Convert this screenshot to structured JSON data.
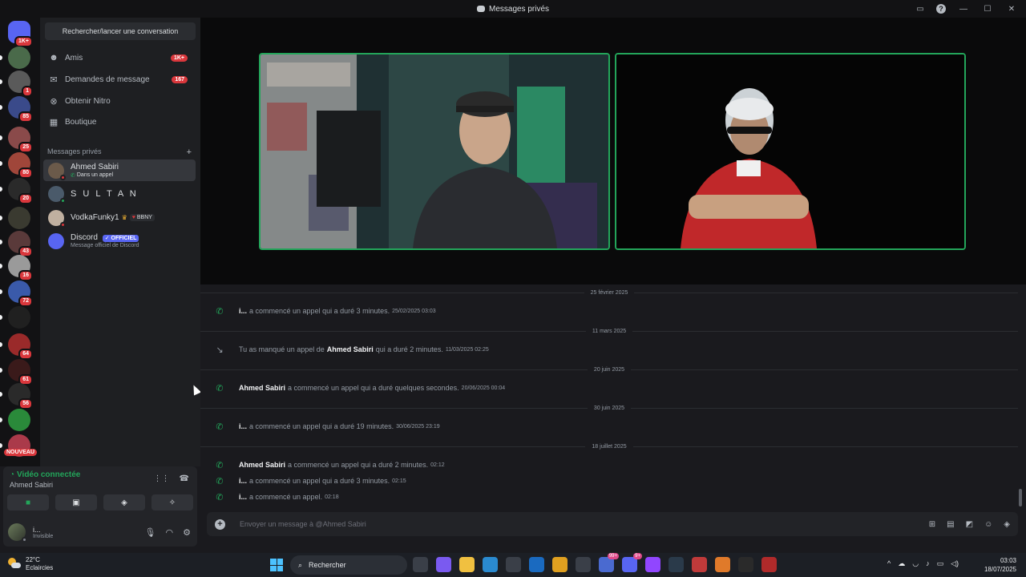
{
  "window": {
    "title": "Messages privés"
  },
  "colors": {
    "accent_green": "#23a55a",
    "badge_red": "#da373c",
    "blurple": "#5865f2"
  },
  "servers": [
    {
      "name": "discord-home",
      "color": "#5865f2",
      "badge": "1K+"
    },
    {
      "name": "server-1",
      "color": "#4a6a4a",
      "badge": ""
    },
    {
      "name": "server-2",
      "color": "#5a5a5a",
      "badge": "1"
    },
    {
      "name": "server-3",
      "color": "#3a4a8a",
      "badge": "85"
    },
    {
      "name": "server-4",
      "color": "#8a4a4a",
      "badge": "25"
    },
    {
      "name": "server-5",
      "color": "#a0463a",
      "badge": "80"
    },
    {
      "name": "server-6",
      "color": "#2a2a2a",
      "badge": "20"
    },
    {
      "name": "server-7",
      "color": "#3a3a30",
      "badge": ""
    },
    {
      "name": "server-8",
      "color": "#5a3a3a",
      "badge": "43"
    },
    {
      "name": "server-9",
      "color": "#9a9a9a",
      "badge": "16"
    },
    {
      "name": "server-10",
      "color": "#3a5aaa",
      "badge": "72"
    },
    {
      "name": "server-11",
      "color": "#202020",
      "badge": ""
    },
    {
      "name": "server-12",
      "color": "#9a2a2a",
      "badge": "64"
    },
    {
      "name": "server-13",
      "color": "#3a1a1a",
      "badge": "61"
    },
    {
      "name": "server-14",
      "color": "#2a2a2a",
      "badge": "56"
    },
    {
      "name": "server-15",
      "color": "#2a8a3a",
      "badge": ""
    },
    {
      "name": "server-16",
      "color": "#aa3a4a",
      "badge": ""
    }
  ],
  "server_new_label": "NOUVEAU",
  "sidebar": {
    "search_label": "Rechercher/lancer une conversation",
    "nav": [
      {
        "label": "Amis",
        "badge": "1K+",
        "icon": "friends-icon"
      },
      {
        "label": "Demandes de message",
        "badge": "167",
        "icon": "inbox-icon"
      },
      {
        "label": "Obtenir Nitro",
        "badge": "",
        "icon": "nitro-icon"
      },
      {
        "label": "Boutique",
        "badge": "",
        "icon": "shop-icon"
      }
    ],
    "section_title": "Messages privés",
    "dms": [
      {
        "name": "Ahmed Sabiri",
        "sub": "Dans un appel",
        "status_color": "#da373c",
        "avatar": "#6b5a4a"
      },
      {
        "name": "S U L T A N",
        "sub": "",
        "status_color": "#23a55a",
        "avatar": "#4a5a6a"
      },
      {
        "name": "VodkaFunky1",
        "tag": "BBNY",
        "status_color": "#da373c",
        "avatar": "#c0b0a0"
      },
      {
        "name": "Discord",
        "badge": "OFFICIEL",
        "sub": "Message officiel de Discord",
        "status_color": "",
        "avatar": "#5865f2"
      }
    ]
  },
  "voice": {
    "status": "Vidéo connectée",
    "channel": "Ahmed Sabiri"
  },
  "user": {
    "name": "i...",
    "status": "Invisible"
  },
  "chat": {
    "entries": [
      {
        "type": "date",
        "label": "25 février 2025"
      },
      {
        "type": "call",
        "missed": false,
        "author": "i...",
        "text": "a commencé un appel qui a duré 3 minutes.",
        "ts": "25/02/2025 03:03"
      },
      {
        "type": "date",
        "label": "11 mars 2025"
      },
      {
        "type": "call",
        "missed": true,
        "prefix": "Tu as manqué un appel de",
        "author": "Ahmed Sabiri",
        "text": "qui a duré 2 minutes.",
        "ts": "11/03/2025 02:25"
      },
      {
        "type": "date",
        "label": "20 juin 2025"
      },
      {
        "type": "call",
        "missed": false,
        "author": "Ahmed Sabiri",
        "text": "a commencé un appel qui a duré quelques secondes.",
        "ts": "20/06/2025 00:04"
      },
      {
        "type": "date",
        "label": "30 juin 2025"
      },
      {
        "type": "call",
        "missed": false,
        "author": "i...",
        "text": "a commencé un appel qui a duré 19 minutes.",
        "ts": "30/06/2025 23:19"
      },
      {
        "type": "date",
        "label": "18 juillet 2025"
      },
      {
        "type": "call",
        "missed": false,
        "author": "Ahmed Sabiri",
        "text": "a commencé un appel qui a duré 2 minutes.",
        "ts": "02:12"
      },
      {
        "type": "call",
        "missed": false,
        "author": "i...",
        "text": "a commencé un appel qui a duré 3 minutes.",
        "ts": "02:15"
      },
      {
        "type": "call",
        "missed": false,
        "author": "i...",
        "text": "a commencé un appel.",
        "ts": "02:18"
      }
    ],
    "composer_placeholder": "Envoyer un message à @Ahmed Sabiri"
  },
  "taskbar": {
    "temperature": "22°C",
    "weather": "Eclaircies",
    "search_label": "Rechercher",
    "apps": [
      {
        "name": "task-view",
        "color": "#3a3f48",
        "badge": ""
      },
      {
        "name": "copilot",
        "color": "#7a5af0",
        "badge": ""
      },
      {
        "name": "file-explorer",
        "color": "#f0c040",
        "badge": ""
      },
      {
        "name": "edge",
        "color": "#2a8ad0",
        "badge": ""
      },
      {
        "name": "store",
        "color": "#3a3f48",
        "badge": ""
      },
      {
        "name": "outlook",
        "color": "#1a6ac0",
        "badge": ""
      },
      {
        "name": "chrome",
        "color": "#e0a020",
        "badge": ""
      },
      {
        "name": "app-folder",
        "color": "#3a3f48",
        "badge": ""
      },
      {
        "name": "teams",
        "color": "#4a6ad0",
        "badge": "99+"
      },
      {
        "name": "discord",
        "color": "#5865f2",
        "badge": "9+"
      },
      {
        "name": "twitch",
        "color": "#9146ff",
        "badge": ""
      },
      {
        "name": "steam",
        "color": "#2a3a4a",
        "badge": ""
      },
      {
        "name": "app-red",
        "color": "#c03a3a",
        "badge": ""
      },
      {
        "name": "app-orange",
        "color": "#e07a2a",
        "badge": ""
      },
      {
        "name": "app-dark",
        "color": "#2a2a2a",
        "badge": ""
      },
      {
        "name": "app-obs",
        "color": "#b02a2a",
        "badge": ""
      }
    ],
    "time": "03:03",
    "date": "18/07/2025"
  }
}
